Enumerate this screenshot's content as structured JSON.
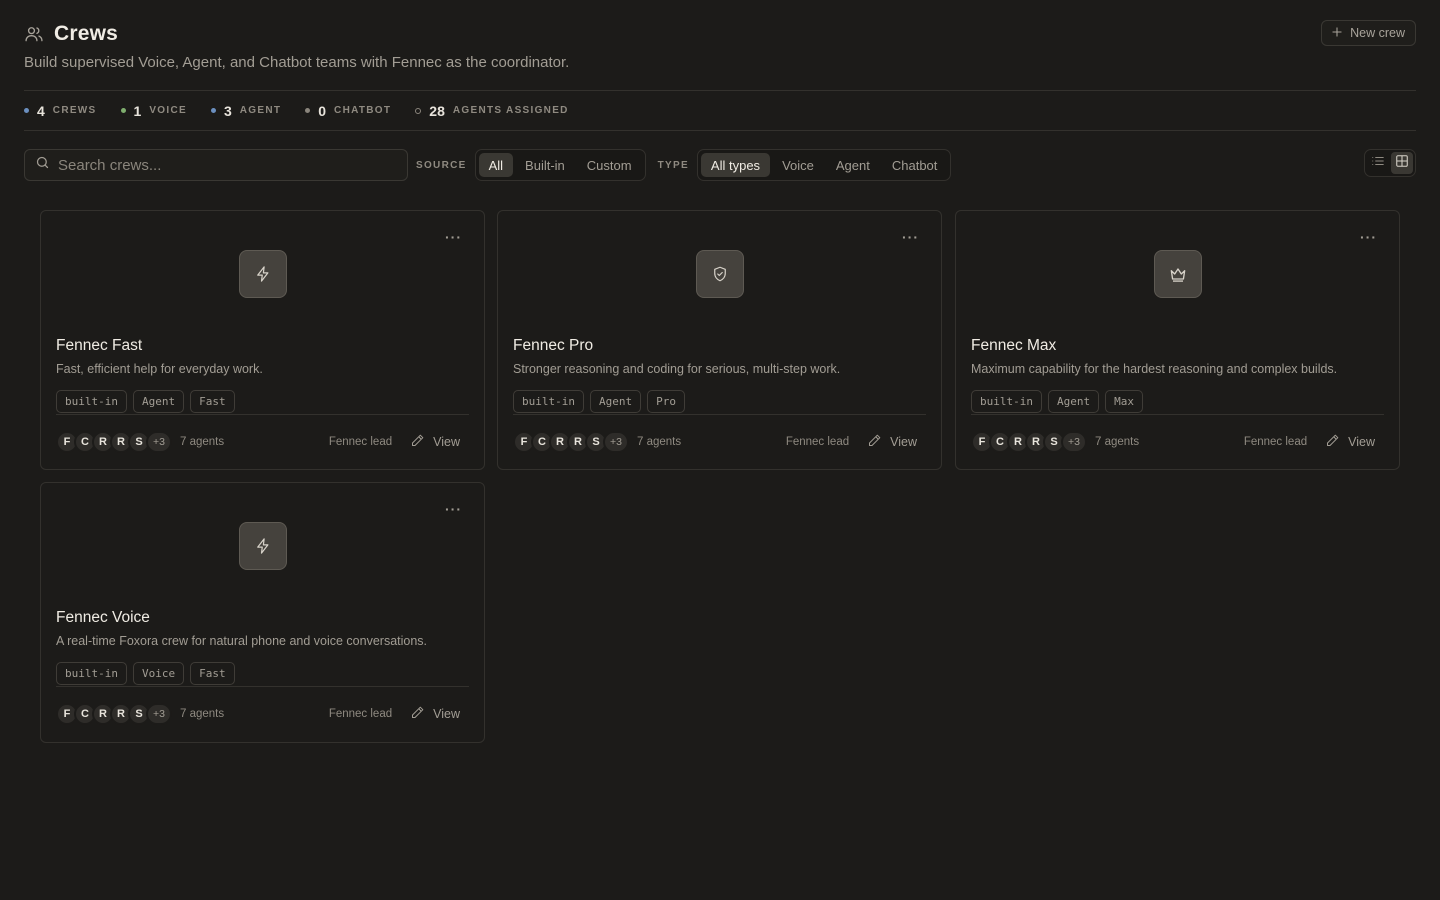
{
  "header": {
    "title": "Crews",
    "subtitle": "Build supervised Voice, Agent, and Chatbot teams with Fennec as the coordinator.",
    "new_crew_label": "New crew"
  },
  "stats": [
    {
      "value": "4",
      "label": "CREWS",
      "color": "#6b8fbf"
    },
    {
      "value": "1",
      "label": "VOICE",
      "color": "#7fae6e"
    },
    {
      "value": "3",
      "label": "AGENT",
      "color": "#6b8fbf"
    },
    {
      "value": "0",
      "label": "CHATBOT",
      "color": "#8a857c"
    },
    {
      "value": "28",
      "label": "AGENTS ASSIGNED",
      "color": "hollow"
    }
  ],
  "search": {
    "placeholder": "Search crews...",
    "value": ""
  },
  "filters": {
    "source_label": "SOURCE",
    "source_options": [
      "All",
      "Built-in",
      "Custom"
    ],
    "source_selected": "All",
    "type_label": "TYPE",
    "type_options": [
      "All types",
      "Voice",
      "Agent",
      "Chatbot"
    ],
    "type_selected": "All types"
  },
  "view_mode": "grid",
  "crews": [
    {
      "name": "Fennec Fast",
      "description": "Fast, efficient help for everyday work.",
      "icon": "lightning-icon",
      "tags": [
        "built-in",
        "Agent",
        "Fast"
      ],
      "avatars": [
        "F",
        "C",
        "R",
        "R",
        "S"
      ],
      "more_avatars": "+3",
      "agent_count": "7 agents",
      "lead": "Fennec lead",
      "view_label": "View"
    },
    {
      "name": "Fennec Pro",
      "description": "Stronger reasoning and coding for serious, multi-step work.",
      "icon": "shield-check-icon",
      "tags": [
        "built-in",
        "Agent",
        "Pro"
      ],
      "avatars": [
        "F",
        "C",
        "R",
        "R",
        "S"
      ],
      "more_avatars": "+3",
      "agent_count": "7 agents",
      "lead": "Fennec lead",
      "view_label": "View"
    },
    {
      "name": "Fennec Max",
      "description": "Maximum capability for the hardest reasoning and complex builds.",
      "icon": "crown-icon",
      "tags": [
        "built-in",
        "Agent",
        "Max"
      ],
      "avatars": [
        "F",
        "C",
        "R",
        "R",
        "S"
      ],
      "more_avatars": "+3",
      "agent_count": "7 agents",
      "lead": "Fennec lead",
      "view_label": "View"
    },
    {
      "name": "Fennec Voice",
      "description": "A real-time Foxora crew for natural phone and voice conversations.",
      "icon": "lightning-icon",
      "tags": [
        "built-in",
        "Voice",
        "Fast"
      ],
      "avatars": [
        "F",
        "C",
        "R",
        "R",
        "S"
      ],
      "more_avatars": "+3",
      "agent_count": "7 agents",
      "lead": "Fennec lead",
      "view_label": "View"
    }
  ]
}
